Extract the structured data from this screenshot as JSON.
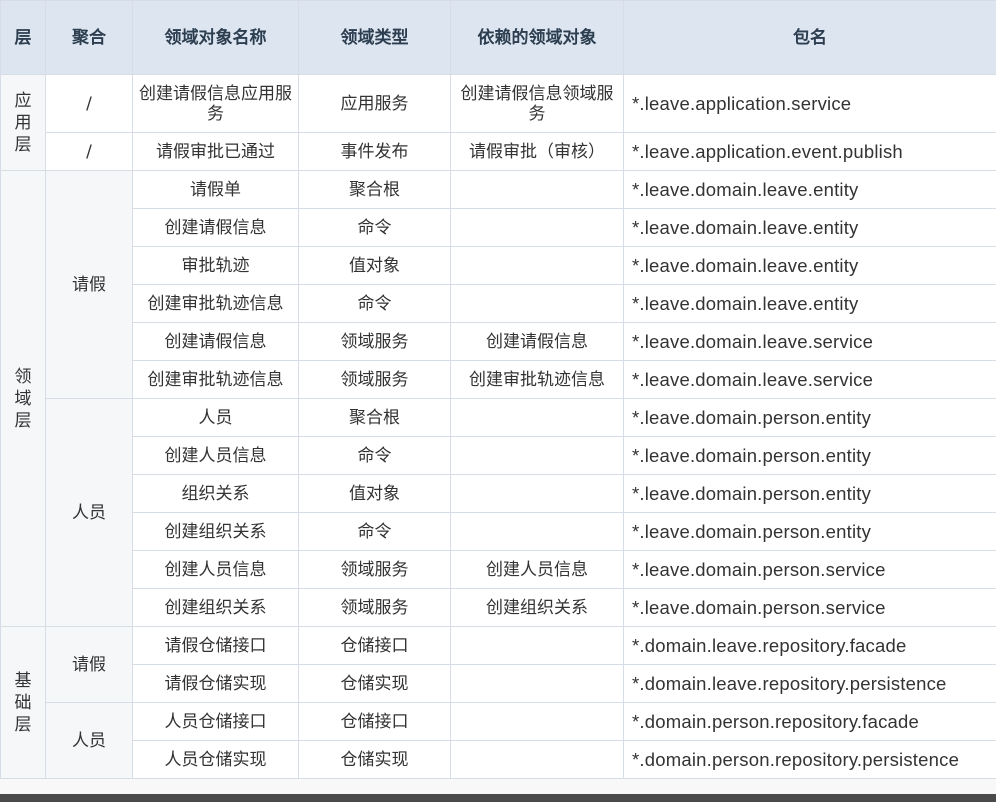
{
  "headers": [
    "层",
    "聚合",
    "领域对象名称",
    "领域类型",
    "依赖的领域对象",
    "包名"
  ],
  "layers": {
    "app": [
      "应",
      "用",
      "层"
    ],
    "domain": [
      "领",
      "域",
      "层"
    ],
    "infra": [
      "基",
      "础",
      "层"
    ]
  },
  "aggregates": {
    "slash": "/",
    "leave": "请假",
    "person": "人员"
  },
  "rows": [
    {
      "name": "创建请假信息应用服务",
      "type": "应用服务",
      "dep": "创建请假信息领域服务",
      "pkg": "*.leave.application.service"
    },
    {
      "name": "请假审批已通过",
      "type": "事件发布",
      "dep": "请假审批（审核）",
      "pkg": "*.leave.application.event.publish"
    },
    {
      "name": "请假单",
      "type": "聚合根",
      "dep": "",
      "pkg": "*.leave.domain.leave.entity"
    },
    {
      "name": "创建请假信息",
      "type": "命令",
      "dep": "",
      "pkg": "*.leave.domain.leave.entity"
    },
    {
      "name": "审批轨迹",
      "type": "值对象",
      "dep": "",
      "pkg": "*.leave.domain.leave.entity"
    },
    {
      "name": "创建审批轨迹信息",
      "type": "命令",
      "dep": "",
      "pkg": "*.leave.domain.leave.entity"
    },
    {
      "name": "创建请假信息",
      "type": "领域服务",
      "dep": "创建请假信息",
      "pkg": "*.leave.domain.leave.service"
    },
    {
      "name": "创建审批轨迹信息",
      "type": "领域服务",
      "dep": "创建审批轨迹信息",
      "pkg": "*.leave.domain.leave.service"
    },
    {
      "name": "人员",
      "type": "聚合根",
      "dep": "",
      "pkg": "*.leave.domain.person.entity"
    },
    {
      "name": "创建人员信息",
      "type": "命令",
      "dep": "",
      "pkg": "*.leave.domain.person.entity"
    },
    {
      "name": "组织关系",
      "type": "值对象",
      "dep": "",
      "pkg": "*.leave.domain.person.entity"
    },
    {
      "name": "创建组织关系",
      "type": "命令",
      "dep": "",
      "pkg": "*.leave.domain.person.entity"
    },
    {
      "name": "创建人员信息",
      "type": "领域服务",
      "dep": "创建人员信息",
      "pkg": "*.leave.domain.person.service"
    },
    {
      "name": "创建组织关系",
      "type": "领域服务",
      "dep": "创建组织关系",
      "pkg": "*.leave.domain.person.service"
    },
    {
      "name": "请假仓储接口",
      "type": "仓储接口",
      "dep": "",
      "pkg": "*.domain.leave.repository.facade"
    },
    {
      "name": "请假仓储实现",
      "type": "仓储实现",
      "dep": "",
      "pkg": "*.domain.leave.repository.persistence"
    },
    {
      "name": "人员仓储接口",
      "type": "仓储接口",
      "dep": "",
      "pkg": "*.domain.person.repository.facade"
    },
    {
      "name": "人员仓储实现",
      "type": "仓储实现",
      "dep": "",
      "pkg": "*.domain.person.repository.persistence"
    }
  ]
}
